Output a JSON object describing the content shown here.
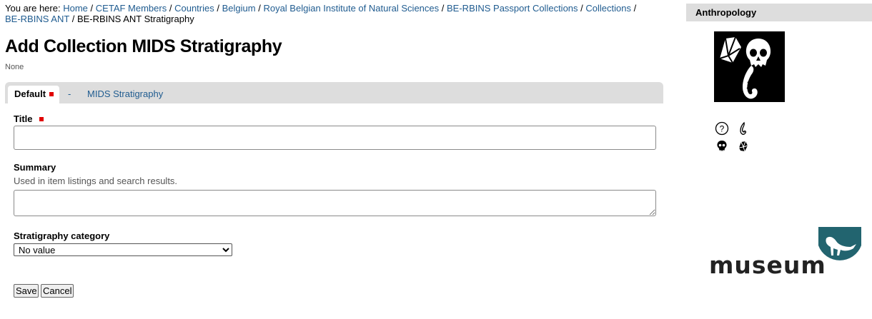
{
  "breadcrumb": {
    "prefix": "You are here:",
    "items": [
      {
        "label": "Home"
      },
      {
        "label": "CETAF Members"
      },
      {
        "label": "Countries"
      },
      {
        "label": "Belgium"
      },
      {
        "label": "Royal Belgian Institute of Natural Sciences"
      },
      {
        "label": "BE-RBINS Passport Collections"
      },
      {
        "label": "Collections"
      },
      {
        "label": "BE-RBINS ANT"
      }
    ],
    "current": "BE-RBINS ANT Stratigraphy",
    "separator": "/"
  },
  "page": {
    "title": "Add Collection MIDS Stratigraphy",
    "description": "None"
  },
  "tabs": {
    "default": "Default",
    "dash": "-",
    "mids": "MIDS Stratigraphy"
  },
  "form": {
    "title_label": "Title",
    "title_value": "",
    "summary_label": "Summary",
    "summary_help": "Used in item listings and search results.",
    "summary_value": "",
    "stratigraphy_label": "Stratigraphy category",
    "stratigraphy_selected": "No value"
  },
  "buttons": {
    "save": "Save",
    "cancel": "Cancel"
  },
  "sidebar": {
    "portlet_title": "Anthropology",
    "help_glyph": "?",
    "icons": [
      "hand-axe-icon",
      "skull-icon",
      "fish-hook-icon",
      "help-icon"
    ],
    "museum_logo_text": "museum"
  },
  "colors": {
    "link": "#205c90",
    "required": "#e00000",
    "tabbar": "#dddddd",
    "logo_teal": "#22646f"
  }
}
